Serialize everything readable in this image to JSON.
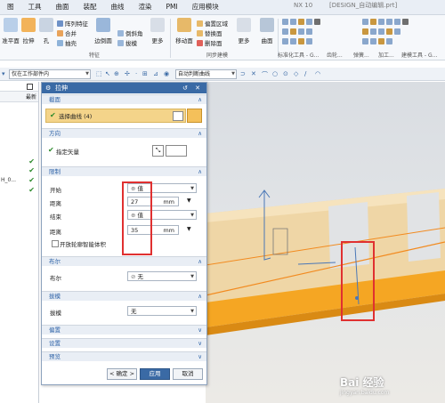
{
  "menubar": {
    "items": [
      "图",
      "工具",
      "曲面",
      "装配",
      "曲线",
      "渲染",
      "PMI",
      "应用模块"
    ],
    "title_fragments": [
      "NX 10",
      "[DESIGN_自动编辑.prt]"
    ]
  },
  "ribbon": {
    "labels": {
      "plane": "准平面",
      "extrude": "拉伸",
      "hole": "孔",
      "array_feature": "阵列特征",
      "unite": "合并",
      "shell": "抽壳",
      "edge_blend": "边倒圆",
      "chamfer": "倒斜角",
      "draft": "拔模",
      "more1": "更多",
      "move_face": "移动面",
      "offset_region": "偏置区域",
      "replace_face": "替换面",
      "delete_face": "删除面",
      "more2": "更多",
      "surface": "曲面",
      "feature_group": "特征",
      "sync_group": "同步建模",
      "std_tools": "标准化工具 - G...",
      "gear": "齿轮...",
      "spring": "弹簧...",
      "process": "加工...",
      "build_tools": "建模工具 - G..."
    }
  },
  "toolbar": {
    "filter_select": "仅在工作部件内",
    "snap_select": "自动判断曲线"
  },
  "navigator": {
    "column_label": "最新",
    "partial_label": "H_0..."
  },
  "dialog": {
    "title": "拉伸",
    "section_headers": {
      "section": "截面",
      "direction": "方向",
      "limits": "限制",
      "boolean": "布尔",
      "draft": "拔模",
      "offset": "偏置",
      "settings": "设置",
      "preview": "预览"
    },
    "select_curve": "选择曲线 (4)",
    "specify_vector": "指定矢量",
    "limits": {
      "start_label": "开始",
      "start_value": "值",
      "distance_label": "距离",
      "start_distance": "27",
      "unit": "mm",
      "end_label": "结束",
      "end_value": "值",
      "end_distance": "35",
      "open_profile": "开放轮廓智能体积"
    },
    "boolean": {
      "label": "布尔",
      "value": "无"
    },
    "draft": {
      "label": "拔模",
      "value": "无"
    },
    "buttons": {
      "ok": "< 确定 >",
      "apply": "应用",
      "cancel": "取消"
    }
  },
  "watermark": {
    "text": "Bai 经验",
    "sub": "jingyan.baidu.com"
  },
  "colors": {
    "accent": "#3a6aa5",
    "highlight_red": "#e03030",
    "check_green": "#2c8a2c",
    "solid_tan": "#efd6a6",
    "solid_orange": "#f5a623"
  }
}
